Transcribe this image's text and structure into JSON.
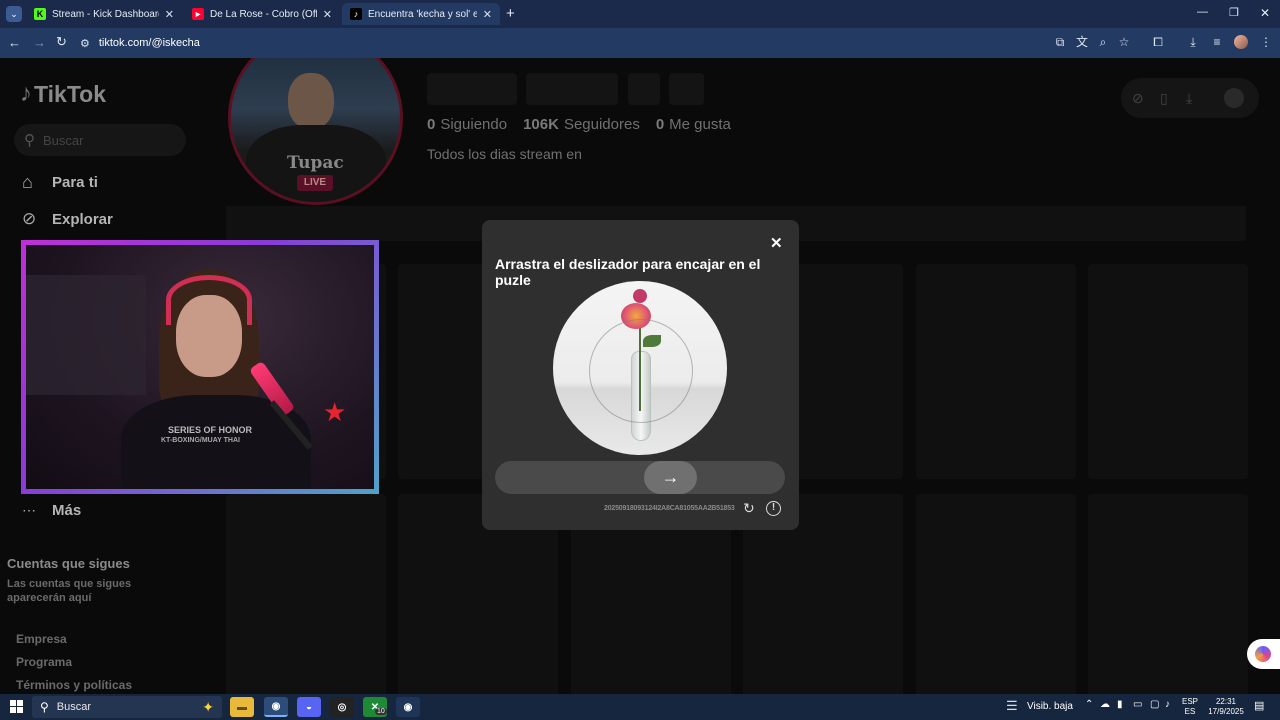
{
  "browser": {
    "tabs": [
      {
        "title": "Stream - Kick Dashboard",
        "icon": "kick-icon"
      },
      {
        "title": "De La Rose - Cobro (Official Vi",
        "icon": "youtube-icon"
      },
      {
        "title": "Encuentra 'kecha y sol' en TikTo",
        "icon": "tiktok-icon"
      }
    ],
    "url": "tiktok.com/@iskecha"
  },
  "tiktok": {
    "logo": "TikTok",
    "search_placeholder": "Buscar",
    "nav": {
      "for_you": "Para ti",
      "explore": "Explorar",
      "more": "Más"
    },
    "following_title": "Cuentas que sigues",
    "following_desc": "Las cuentas que sigues aparecerán aquí",
    "footer": {
      "company": "Empresa",
      "program": "Programa",
      "terms": "Términos y políticas"
    },
    "profile": {
      "live_badge": "LIVE",
      "following_count": "0",
      "following_label": "Siguiendo",
      "followers_count": "106K",
      "followers_label": "Seguidores",
      "likes_count": "0",
      "likes_label": "Me gusta",
      "bio": "Todos los dias stream en",
      "shirt_text": "Tupac"
    },
    "webcam": {
      "shirt_text_1": "SERIES OF HONOR",
      "shirt_text_2": "KT-BOXING/MUAY THAI"
    }
  },
  "captcha": {
    "title": "Arrastra el deslizador para encajar en el puzle",
    "captcha_id": "20250918093124I2A8CA81055AA2B51853",
    "close_icon": "close-icon",
    "slider_icon": "arrow-right-icon"
  },
  "taskbar": {
    "search": "Buscar",
    "weather": "Visib. baja",
    "lang_1": "ESP",
    "lang_2": "ES",
    "time": "22:31",
    "date": "17/9/2025",
    "badge": "10"
  }
}
